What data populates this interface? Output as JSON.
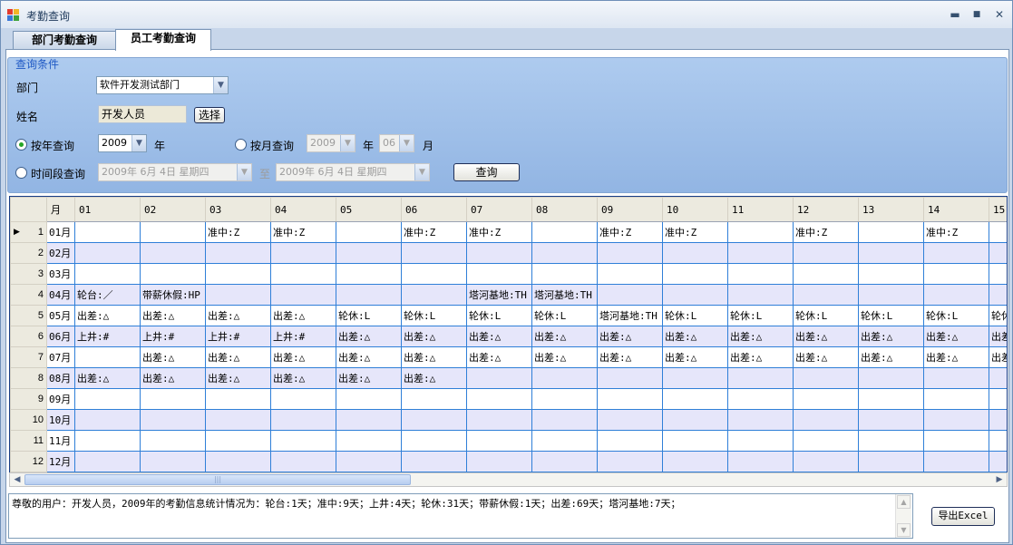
{
  "window": {
    "title": "考勤查询",
    "min_glyph": "▬",
    "max_glyph": "■",
    "close_glyph": "✕"
  },
  "tabs": [
    {
      "label": "部门考勤查询"
    },
    {
      "label": "员工考勤查询"
    }
  ],
  "query": {
    "group_title": "查询条件",
    "dept_label": "部门",
    "dept_value": "软件开发测试部门",
    "name_label": "姓名",
    "name_value": "开发人员",
    "select_button": "选择",
    "by_year_label": "按年查询",
    "year_value": "2009",
    "year_unit": "年",
    "by_month_label": "按月查询",
    "month_year_value": "2009",
    "month_year_unit": "年",
    "month_value": "06",
    "month_unit": "月",
    "period_label": "时间段查询",
    "period_from": "2009年  6月  4日  星期四",
    "period_to_label": "至",
    "period_to": "2009年  6月  4日  星期四",
    "query_button": "查询"
  },
  "grid": {
    "columns": [
      "月",
      "01",
      "02",
      "03",
      "04",
      "05",
      "06",
      "07",
      "08",
      "09",
      "10",
      "11",
      "12",
      "13",
      "14",
      "15"
    ],
    "rows": [
      {
        "num": "1",
        "cells": [
          "01月",
          "",
          "",
          "准中:Z",
          "准中:Z",
          "",
          "准中:Z",
          "准中:Z",
          "",
          "准中:Z",
          "准中:Z",
          "",
          "准中:Z",
          "",
          "准中:Z",
          ""
        ]
      },
      {
        "num": "2",
        "cells": [
          "02月",
          "",
          "",
          "",
          "",
          "",
          "",
          "",
          "",
          "",
          "",
          "",
          "",
          "",
          "",
          ""
        ]
      },
      {
        "num": "3",
        "cells": [
          "03月",
          "",
          "",
          "",
          "",
          "",
          "",
          "",
          "",
          "",
          "",
          "",
          "",
          "",
          "",
          ""
        ]
      },
      {
        "num": "4",
        "cells": [
          "04月",
          "轮台:／",
          "带薪休假:HP",
          "",
          "",
          "",
          "",
          "塔河基地:TH",
          "塔河基地:TH",
          "",
          "",
          "",
          "",
          "",
          "",
          ""
        ]
      },
      {
        "num": "5",
        "cells": [
          "05月",
          "出差:△",
          "出差:△",
          "出差:△",
          "出差:△",
          "轮休:L",
          "轮休:L",
          "轮休:L",
          "轮休:L",
          "塔河基地:TH",
          "轮休:L",
          "轮休:L",
          "轮休:L",
          "轮休:L",
          "轮休:L",
          "轮休"
        ]
      },
      {
        "num": "6",
        "cells": [
          "06月",
          "上井:#",
          "上井:#",
          "上井:#",
          "上井:#",
          "出差:△",
          "出差:△",
          "出差:△",
          "出差:△",
          "出差:△",
          "出差:△",
          "出差:△",
          "出差:△",
          "出差:△",
          "出差:△",
          "出差"
        ]
      },
      {
        "num": "7",
        "cells": [
          "07月",
          "",
          "出差:△",
          "出差:△",
          "出差:△",
          "出差:△",
          "出差:△",
          "出差:△",
          "出差:△",
          "出差:△",
          "出差:△",
          "出差:△",
          "出差:△",
          "出差:△",
          "出差:△",
          "出差"
        ]
      },
      {
        "num": "8",
        "cells": [
          "08月",
          "出差:△",
          "出差:△",
          "出差:△",
          "出差:△",
          "出差:△",
          "出差:△",
          "",
          "",
          "",
          "",
          "",
          "",
          "",
          "",
          ""
        ]
      },
      {
        "num": "9",
        "cells": [
          "09月",
          "",
          "",
          "",
          "",
          "",
          "",
          "",
          "",
          "",
          "",
          "",
          "",
          "",
          "",
          ""
        ]
      },
      {
        "num": "10",
        "cells": [
          "10月",
          "",
          "",
          "",
          "",
          "",
          "",
          "",
          "",
          "",
          "",
          "",
          "",
          "",
          "",
          ""
        ]
      },
      {
        "num": "11",
        "cells": [
          "11月",
          "",
          "",
          "",
          "",
          "",
          "",
          "",
          "",
          "",
          "",
          "",
          "",
          "",
          "",
          ""
        ]
      },
      {
        "num": "12",
        "cells": [
          "12月",
          "",
          "",
          "",
          "",
          "",
          "",
          "",
          "",
          "",
          "",
          "",
          "",
          "",
          "",
          ""
        ]
      }
    ],
    "current_row_marker": "▶"
  },
  "summary_text": "尊敬的用户：开发人员，2009年的考勤信息统计情况为：轮台:1天；准中:9天；上井:4天；轮休:31天；带薪休假:1天；出差:69天；塔河基地:7天；",
  "export_button": "导出Excel"
}
